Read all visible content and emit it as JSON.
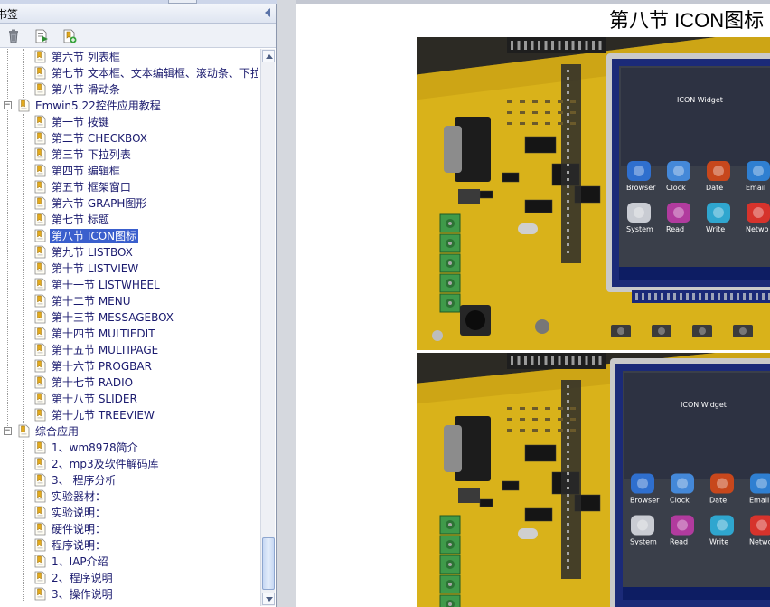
{
  "panel": {
    "title": "书签",
    "toolbar": [
      {
        "icon": "trash-icon"
      },
      {
        "icon": "bookmark-options-icon"
      },
      {
        "icon": "new-bookmark-icon"
      }
    ]
  },
  "tree": {
    "items": [
      {
        "label": "第六节 列表框",
        "level": 2
      },
      {
        "label": "第七节 文本框、文本编辑框、滚动条、下拉",
        "level": 2
      },
      {
        "label": "第八节 滑动条",
        "level": 2
      },
      {
        "label": "Emwin5.22控件应用教程",
        "level": 1,
        "expander": "−"
      },
      {
        "label": "第一节 按键",
        "level": 2
      },
      {
        "label": "第二节 CHECKBOX",
        "level": 2
      },
      {
        "label": "第三节 下拉列表",
        "level": 2
      },
      {
        "label": "第四节 编辑框",
        "level": 2
      },
      {
        "label": "第五节 框架窗口",
        "level": 2
      },
      {
        "label": "第六节 GRAPH图形",
        "level": 2
      },
      {
        "label": "第七节 标题",
        "level": 2
      },
      {
        "label": "第八节 ICON图标",
        "level": 2,
        "selected": true
      },
      {
        "label": "第九节 LISTBOX",
        "level": 2
      },
      {
        "label": "第十节 LISTVIEW",
        "level": 2
      },
      {
        "label": "第十一节 LISTWHEEL",
        "level": 2
      },
      {
        "label": "第十二节 MENU",
        "level": 2
      },
      {
        "label": "第十三节 MESSAGEBOX",
        "level": 2
      },
      {
        "label": "第十四节 MULTIEDIT",
        "level": 2
      },
      {
        "label": "第十五节 MULTIPAGE",
        "level": 2
      },
      {
        "label": "第十六节 PROGBAR",
        "level": 2
      },
      {
        "label": "第十七节 RADIO",
        "level": 2
      },
      {
        "label": "第十八节 SLIDER",
        "level": 2
      },
      {
        "label": "第十九节 TREEVIEW",
        "level": 2
      },
      {
        "label": "综合应用",
        "level": 1,
        "expander": "−"
      },
      {
        "label": "1、wm8978简介",
        "level": 2
      },
      {
        "label": "2、mp3及软件解码库",
        "level": 2
      },
      {
        "label": "3、 程序分析",
        "level": 2
      },
      {
        "label": "实验器材：",
        "level": 2
      },
      {
        "label": "实验说明：",
        "level": 2
      },
      {
        "label": "硬件说明：",
        "level": 2
      },
      {
        "label": "程序说明：",
        "level": 2
      },
      {
        "label": "1、IAP介绍",
        "level": 2
      },
      {
        "label": "2、程序说明",
        "level": 2
      },
      {
        "label": "3、操作说明",
        "level": 2
      }
    ]
  },
  "document": {
    "heading": "第八节 ICON图标",
    "photos": [
      {
        "name": "board-photo-1",
        "apps": [
          "Browser",
          "Clock",
          "Date",
          "Email",
          "System",
          "Read",
          "Write",
          "Netwo"
        ],
        "screen_caption": "ICON Widget"
      },
      {
        "name": "board-photo-2",
        "apps": [
          "Browser",
          "Clock",
          "Date",
          "Email",
          "System",
          "Read",
          "Write",
          "Netwo"
        ],
        "screen_caption": "ICON Widget"
      }
    ]
  },
  "colors": {
    "selection": "#3a5fcd",
    "tree_text": "#1a1a6e",
    "board_yellow": "#d9b21a",
    "connector_green": "#3f9a4a",
    "lcd_frame": "#1b2a78"
  }
}
